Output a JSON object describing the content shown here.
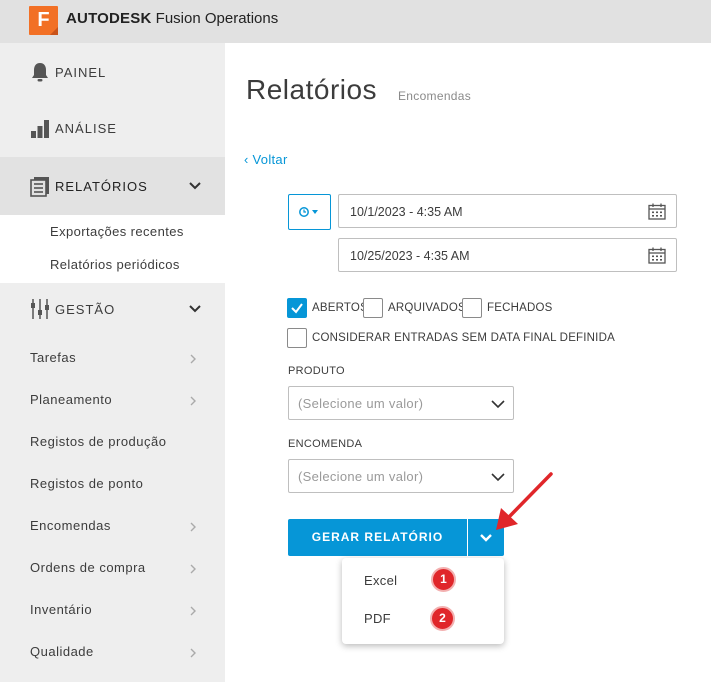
{
  "header": {
    "logo_letter": "F",
    "brand_bold": "AUTODESK",
    "brand_rest": "Fusion Operations",
    "brand_color": "#f27025"
  },
  "sidebar": {
    "main": [
      {
        "label": "PAINEL",
        "icon": "bell-icon"
      },
      {
        "label": "ANÁLISE",
        "icon": "bar-chart-icon"
      },
      {
        "label": "RELATÓRIOS",
        "icon": "reports-icon"
      },
      {
        "label": "GESTÃO",
        "icon": "sliders-icon"
      }
    ],
    "reports_sub": [
      "Exportações recentes",
      "Relatórios periódicos"
    ],
    "items": [
      "Tarefas",
      "Planeamento",
      "Registos de produção",
      "Registos de ponto",
      "Encomendas",
      "Ordens de compra",
      "Inventário",
      "Qualidade"
    ]
  },
  "main": {
    "title": "Relatórios",
    "subtitle": "Encomendas",
    "back": "‹ Voltar",
    "date_from": "10/1/2023 - 4:35 AM",
    "date_to": "10/25/2023 - 4:35 AM",
    "checkboxes": [
      {
        "label": "ABERTOS",
        "checked": true
      },
      {
        "label": "ARQUIVADOS",
        "checked": false
      },
      {
        "label": "FECHADOS",
        "checked": false
      }
    ],
    "consider_label": "CONSIDERAR ENTRADAS SEM DATA FINAL DEFINIDA",
    "product_label": "PRODUTO",
    "product_placeholder": "(Selecione um valor)",
    "order_label": "ENCOMENDA",
    "order_placeholder": "(Selecione um valor)",
    "generate_label": "GERAR RELATÓRIO",
    "menu": [
      "Excel",
      "PDF"
    ],
    "badges": [
      "1",
      "2"
    ]
  },
  "colors": {
    "accent": "#0696d7",
    "badge": "#e0262a",
    "arrow": "#e0262a"
  }
}
